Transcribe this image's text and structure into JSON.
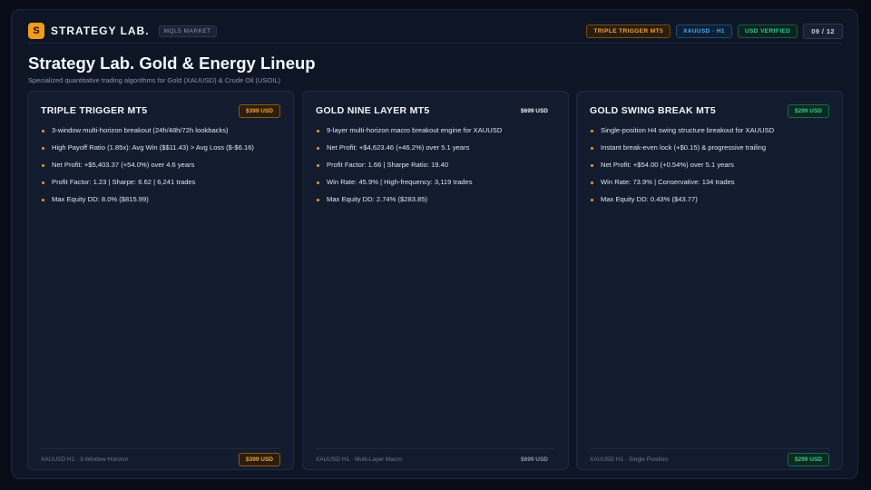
{
  "header": {
    "logo_letter": "S",
    "brand": "STRATEGY LAB.",
    "market_tag": "MQL5 MARKET",
    "chips": [
      {
        "label": "TRIPLE TRIGGER MT5",
        "color": "#f4a43a"
      },
      {
        "label": "XAUUSD · H1",
        "color": "#4aa8f0"
      },
      {
        "label": "USD VERIFIED",
        "color": "#35c98d"
      }
    ],
    "page_indicator": "09 / 12"
  },
  "page": {
    "title": "Strategy Lab. Gold & Energy Lineup",
    "subtitle": "Specialized quantitative trading algorithms for Gold (XAUUSD) & Crude Oil (USOIL)"
  },
  "cards": [
    {
      "title": "TRIPLE TRIGGER MT5",
      "price": "$399 USD",
      "bullets": [
        "3-window multi-horizon breakout (24h/48h/72h lookbacks)",
        "High Payoff Ratio (1.85x): Avg Win ($$11.43) > Avg Loss ($-$6.16)",
        "Net Profit: +$5,403.37 (+54.0%) over 4.6 years",
        "Profit Factor: 1.23  |  Sharpe: 6.62  |  6,241 trades",
        "Max Equity DD: 8.0% ($815.99)"
      ],
      "footer": "XAUUSD H1 · 3-Window Horizon",
      "footer_price": "$399 USD"
    },
    {
      "title": "GOLD NINE LAYER MT5",
      "price": "$699 USD",
      "bullets": [
        "9-layer multi-horizon macro breakout engine for XAUUSD",
        "Net Profit: +$4,623.46 (+46.2%) over 5.1 years",
        "Profit Factor: 1.66  |  Sharpe Ratio: 19.40",
        "Win Rate: 45.9%  |  High-frequency: 3,119 trades",
        "Max Equity DD: 2.74% ($283.85)"
      ],
      "footer": "XAUUSD H1 · Multi-Layer Macro",
      "footer_price": "$699 USD"
    },
    {
      "title": "GOLD SWING BREAK MT5",
      "price": "$299 USD",
      "bullets": [
        "Single-position H4 swing structure breakout for XAUUSD",
        "Instant break-even lock (+$0.15) & progressive trailing",
        "Net Profit: +$54.00 (+0.54%) over 5.1 years",
        "Win Rate: 73.9%  |  Conservative: 134 trades",
        "Max Equity DD: 0.43% ($43.77)"
      ],
      "footer": "XAUUSD H1 · Single Position",
      "footer_price": "$299 USD"
    }
  ]
}
